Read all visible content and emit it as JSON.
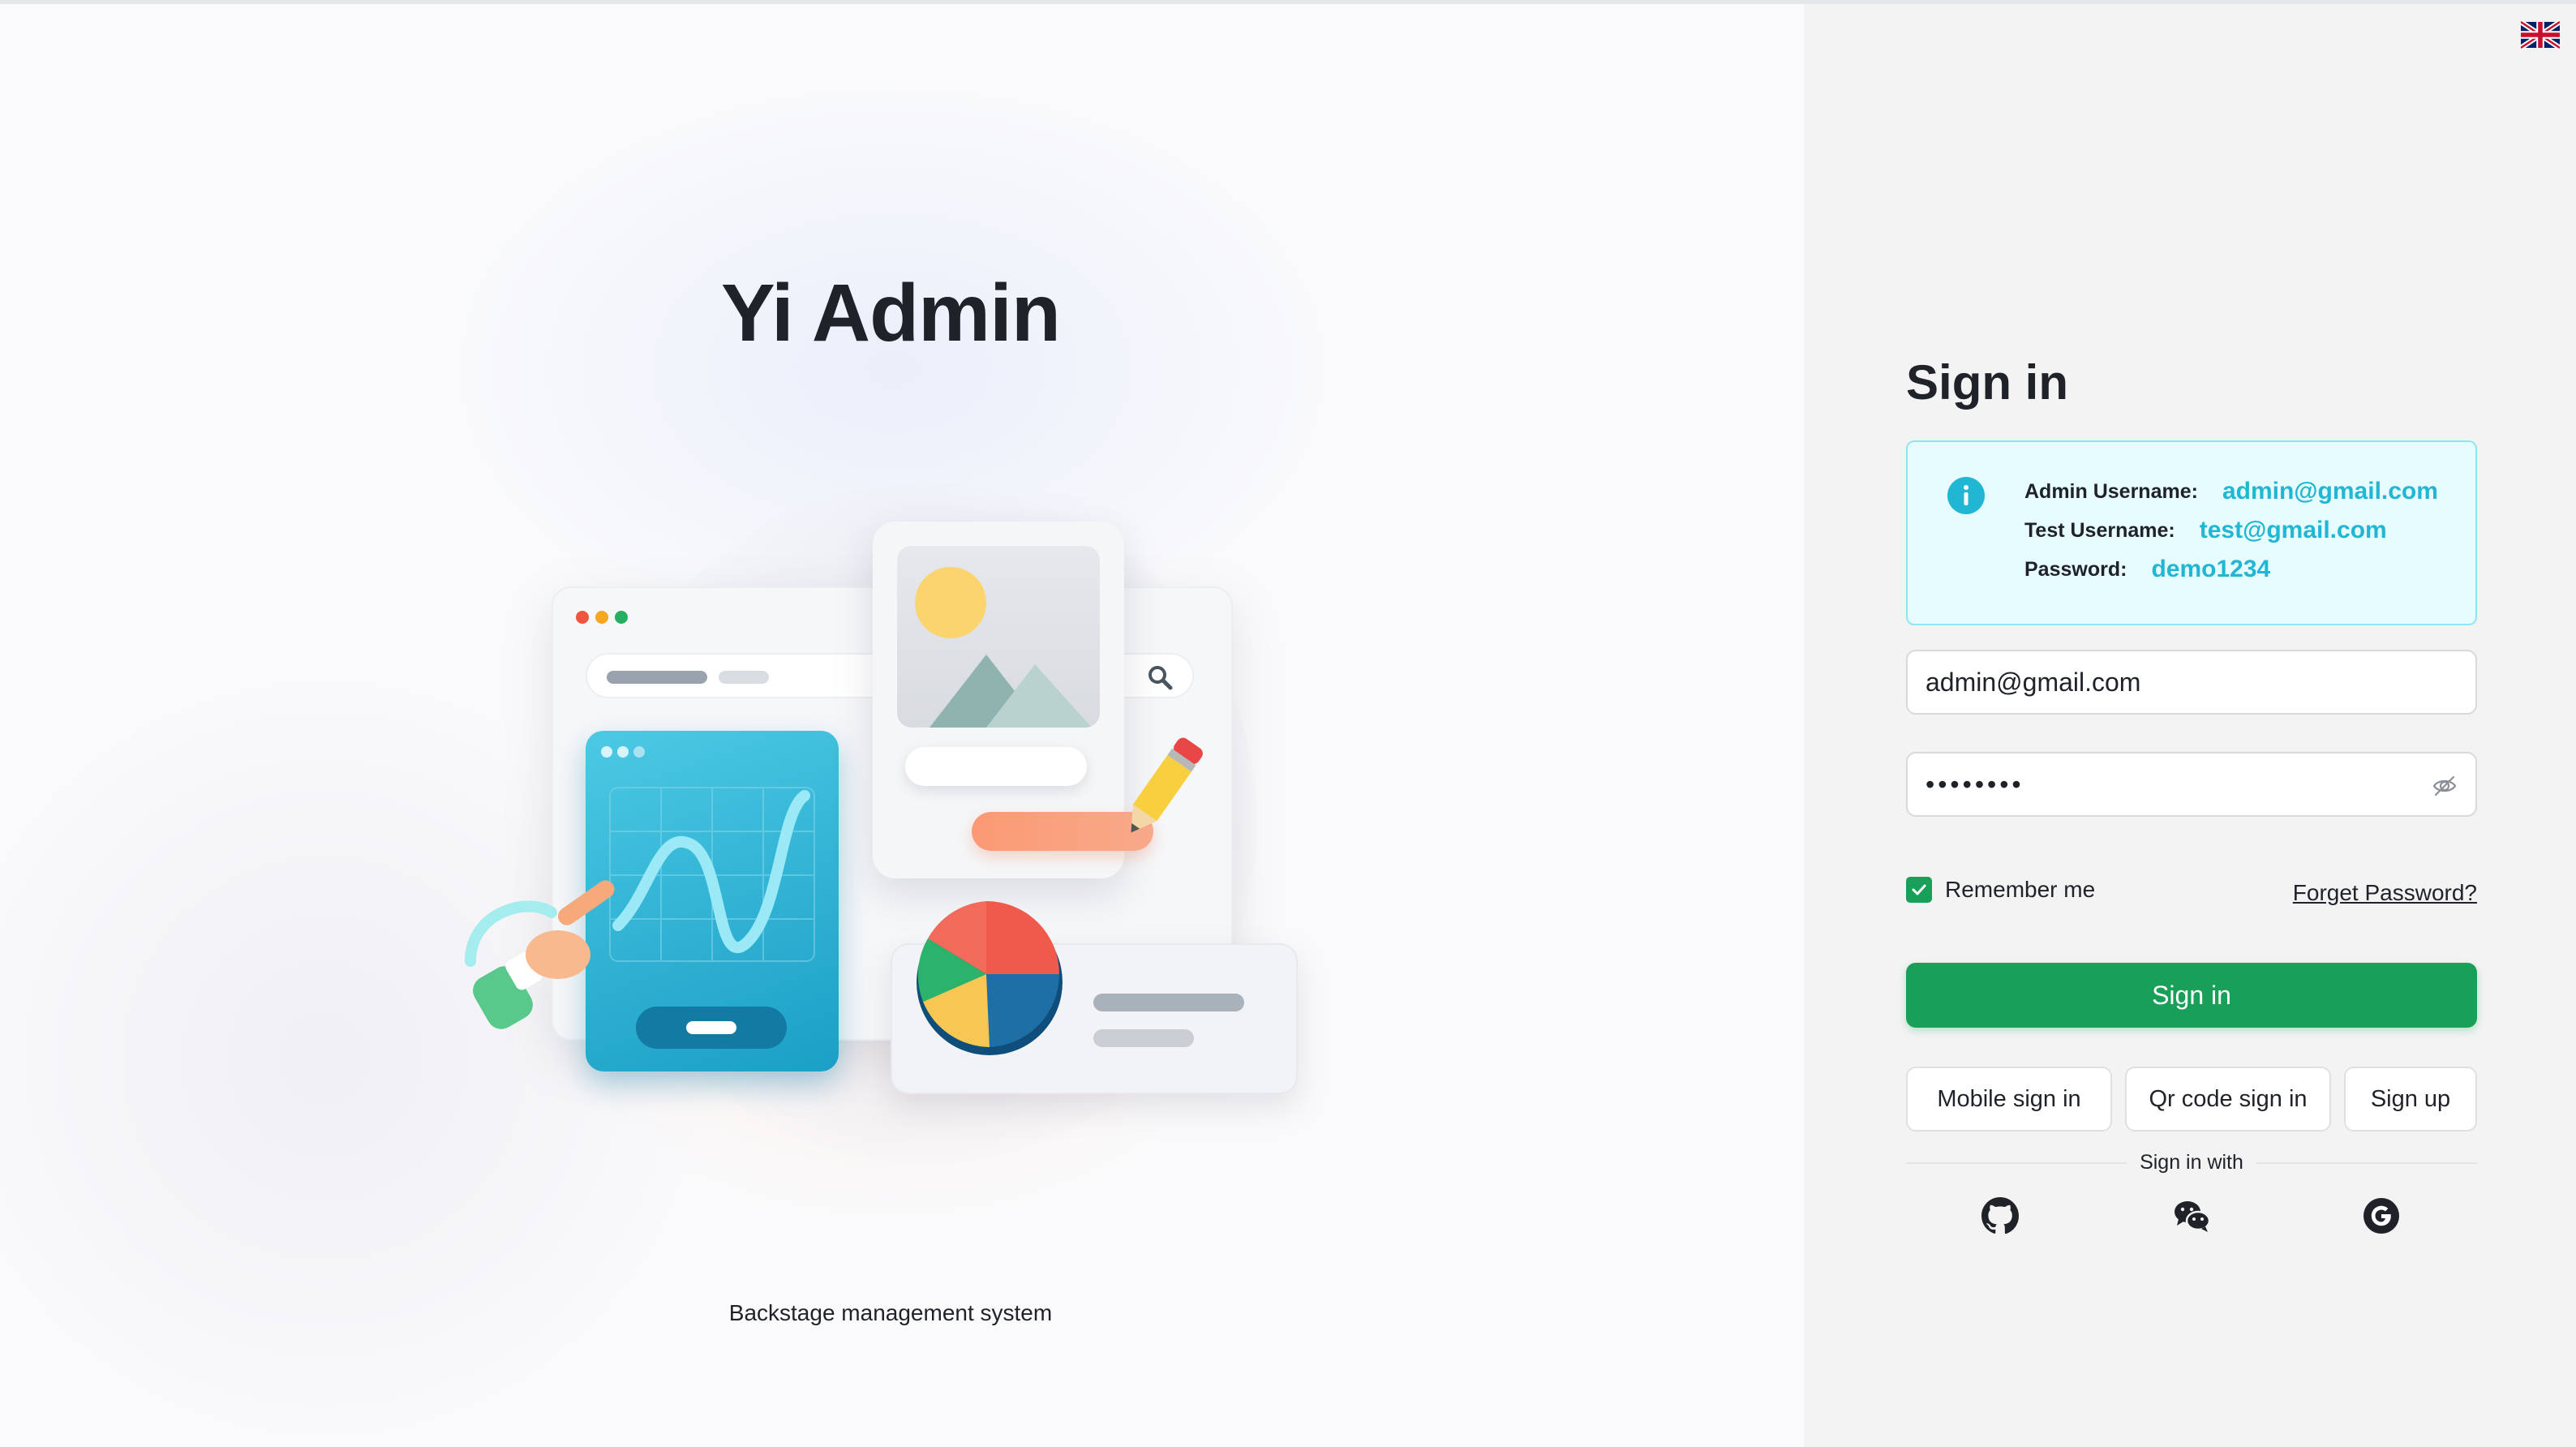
{
  "hero": {
    "title": "Yi Admin",
    "subtitle": "Backstage management system"
  },
  "language": {
    "icon": "uk-flag-icon"
  },
  "signin": {
    "title": "Sign in",
    "info": {
      "icon": "info-icon",
      "admin_label": "Admin Username:",
      "admin_value": "admin@gmail.com",
      "test_label": "Test Username:",
      "test_value": "test@gmail.com",
      "password_label": "Password:",
      "password_value": "demo1234"
    },
    "username_value": "admin@gmail.com",
    "password_mask": "••••••••",
    "password_toggle_icon": "eye-off-icon",
    "remember_label": "Remember me",
    "remember_checked": true,
    "forget_label": "Forget Password?",
    "submit_label": "Sign in",
    "alt_buttons": [
      "Mobile sign in",
      "Qr code sign in",
      "Sign up"
    ],
    "divider_label": "Sign in with",
    "social": [
      "github-icon",
      "wechat-icon",
      "google-icon"
    ]
  },
  "colors": {
    "primary": "#18a058",
    "info_border": "#8fe6f2",
    "info_bg": "#e6fcff",
    "info_accent": "#21b6d4",
    "side_bg": "#f3f3f3"
  }
}
